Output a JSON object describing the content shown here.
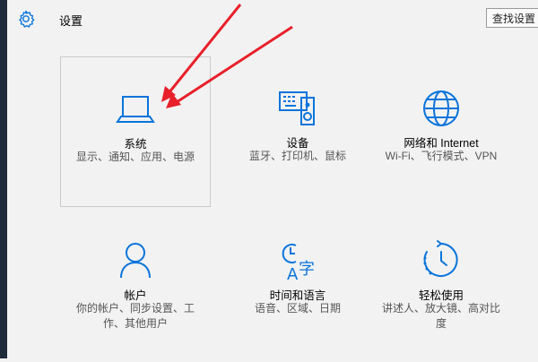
{
  "header": {
    "title": "设置",
    "search_placeholder": "查找设置",
    "gear_icon": "gear-icon"
  },
  "tiles": [
    {
      "name": "系统",
      "desc": "显示、通知、应用、电源",
      "icon": "laptop-icon"
    },
    {
      "name": "设备",
      "desc": "蓝牙、打印机、鼠标",
      "icon": "devices-icon"
    },
    {
      "name": "网络和 Internet",
      "desc": "Wi-Fi、飞行模式、VPN",
      "icon": "globe-icon"
    },
    {
      "name": "帐户",
      "desc": "你的帐户、同步设置、工作、其他用户",
      "icon": "person-icon"
    },
    {
      "name": "时间和语言",
      "desc": "语音、区域、日期",
      "icon": "time-language-icon"
    },
    {
      "name": "轻松使用",
      "desc": "讲述人、放大镜、高对比度",
      "icon": "ease-of-access-icon"
    }
  ],
  "colors": {
    "accent": "#0a74da",
    "annotation_arrow": "#e8202a"
  }
}
